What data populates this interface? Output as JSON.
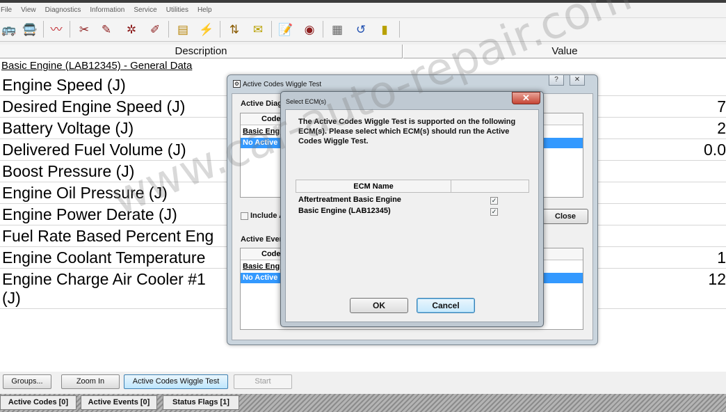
{
  "menubar": {
    "items": [
      "File",
      "View",
      "Diagnostics",
      "Information",
      "Service",
      "Utilities",
      "Help"
    ]
  },
  "toolbar": {
    "icons": [
      "vehicle-icon",
      "vehicle-alt-icon",
      "waveform-icon",
      "tool-a-icon",
      "tool-b-icon",
      "tool-c-icon",
      "tool-d-icon",
      "book-icon",
      "flash-icon",
      "arrows-icon",
      "tag-icon",
      "notepad-icon",
      "target-icon",
      "settings-grid-icon",
      "reset-arrow-icon",
      "battery-icon"
    ]
  },
  "grid": {
    "columns": {
      "description": "Description",
      "value": "Value"
    },
    "group_title": "Basic Engine (LAB12345) - General Data",
    "rows": [
      {
        "label": "Engine Speed (J)",
        "value": ""
      },
      {
        "label": "Desired Engine Speed (J)",
        "value": "7"
      },
      {
        "label": "Battery Voltage (J)",
        "value": "2"
      },
      {
        "label": "Delivered Fuel Volume (J)",
        "value": "0.0"
      },
      {
        "label": "Boost Pressure (J)",
        "value": ""
      },
      {
        "label": "Engine Oil Pressure (J)",
        "value": ""
      },
      {
        "label": "Engine Power Derate (J)",
        "value": ""
      },
      {
        "label": "Fuel Rate Based Percent Eng",
        "value": ""
      },
      {
        "label": "Engine Coolant Temperature",
        "value": "1"
      },
      {
        "label": "Engine Charge Air Cooler #1",
        "label2": "(J)",
        "value": "12"
      }
    ]
  },
  "buttons": {
    "groups": "Groups...",
    "zoom_in": "Zoom In",
    "wiggle": "Active Codes Wiggle Test",
    "start": "Start"
  },
  "status_tabs": {
    "codes": "Active Codes [0]",
    "events": "Active Events [0]",
    "flags": "Status Flags [1]"
  },
  "wiggle_dialog": {
    "title": "Active Codes Wiggle Test",
    "help": "?",
    "close_x": "✕",
    "diag_label": "Active Diag",
    "code_header": "Code",
    "diag_row1": "Basic Eng",
    "diag_row2": "No Active",
    "include_label": "Include A",
    "close_button": "Close",
    "events_label": "Active Even",
    "events_code_header": "Code",
    "events_row1": "Basic Eng",
    "events_row2": "No Active"
  },
  "ecm_dialog": {
    "title": "Select ECM(s)",
    "close_x": "✕",
    "message": "The Active Codes Wiggle Test is supported on the following ECM(s). Please select which ECM(s) should run the Active Codes Wiggle Test.",
    "column": "ECM Name",
    "rows": [
      {
        "name": "Aftertreatment Basic Engine",
        "checked": true
      },
      {
        "name": "Basic Engine (LAB12345)",
        "checked": true
      }
    ],
    "ok": "OK",
    "cancel": "Cancel"
  },
  "watermark": "www.car-auto-repair.com",
  "colors": {
    "selection": "#3399ff",
    "dialog_frame": "#c9d4dd",
    "close_red": "#c64534"
  }
}
